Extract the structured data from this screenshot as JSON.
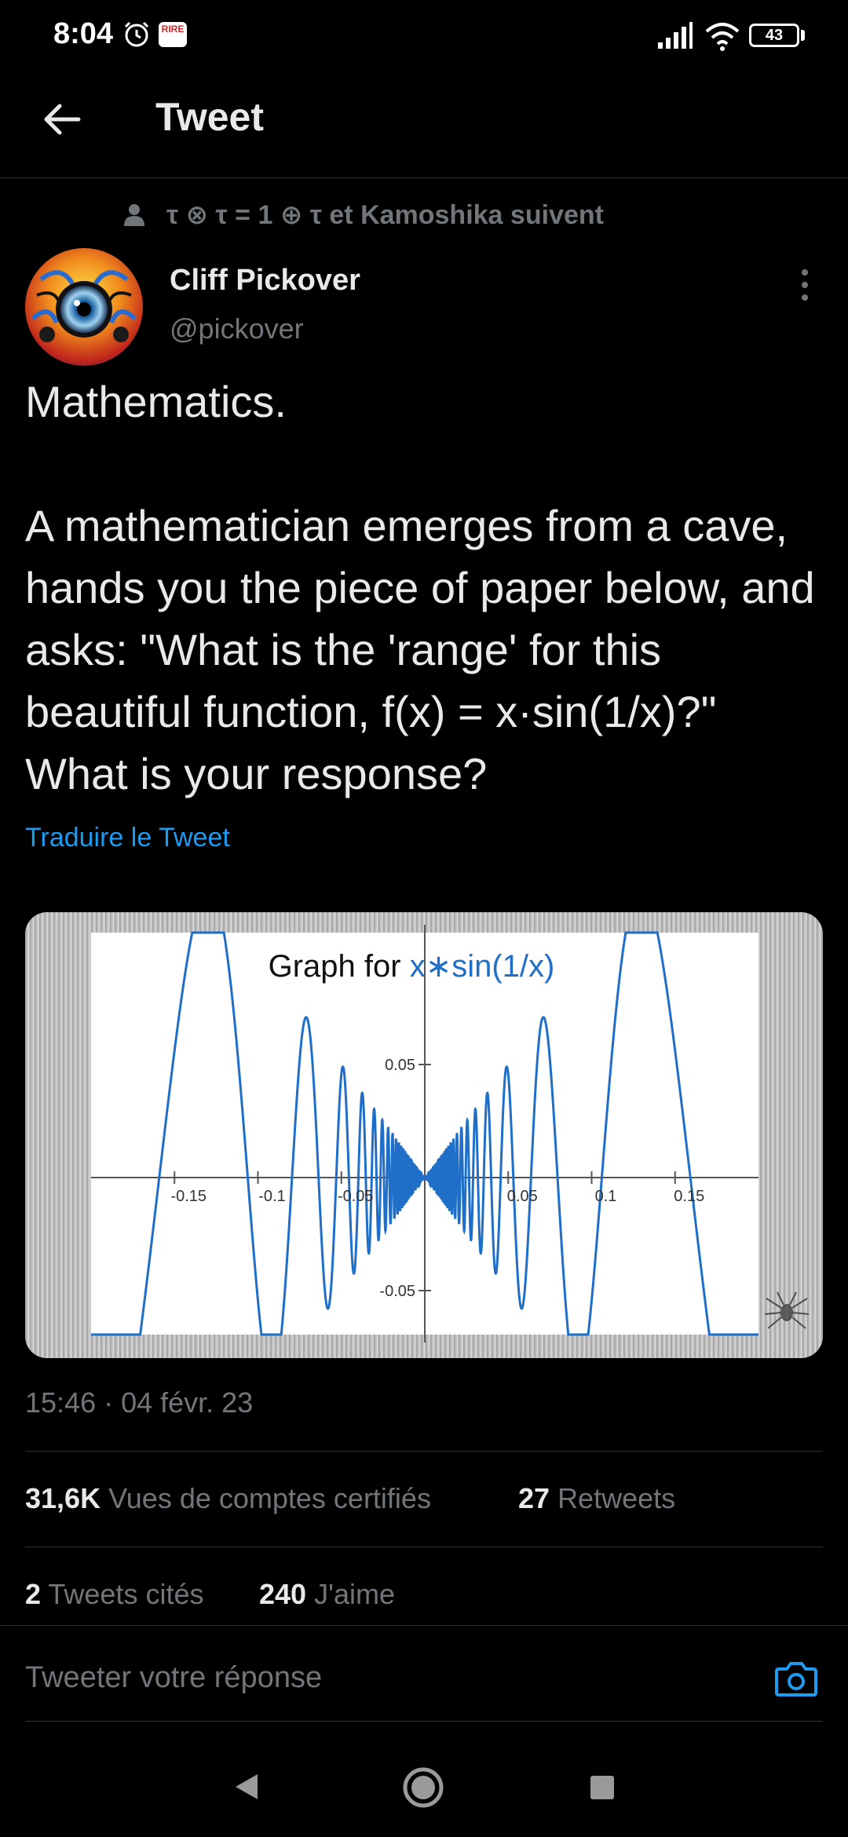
{
  "status_bar": {
    "time": "8:04",
    "app_badge": "RIRE",
    "battery": "43"
  },
  "header": {
    "title": "Tweet"
  },
  "social_context": "τ ⊗ τ = 1 ⊕ τ et Kamoshika suivent",
  "author": {
    "name": "Cliff Pickover",
    "handle": "@pickover"
  },
  "tweet": {
    "text": "Mathematics.\n\nA mathematician emerges from a cave, hands you the piece of paper below, and asks: \"What is the 'range' for this beautiful function, f(x) = x·sin(1/x)?\" What is your response?",
    "translate_label": "Traduire le Tweet"
  },
  "chart_data": {
    "type": "line",
    "title_prefix": "Graph for ",
    "title_expr": "x∗sin(1/x)",
    "function": "x*sin(1/x)",
    "xlim": [
      -0.2,
      0.2
    ],
    "ylim": [
      -0.1,
      0.1
    ],
    "x_ticks": [
      "-0.15",
      "-0.1",
      "-0.05",
      "0.05",
      "0.1",
      "0.15"
    ],
    "y_ticks": [
      "0.05",
      "-0.05"
    ],
    "grid": false,
    "line_color": "#1f6fc8"
  },
  "meta": {
    "timestamp": "15:46 · 04 févr. 23",
    "views_count": "31,6K",
    "views_label": "Vues de comptes certifiés",
    "retweets_count": "27",
    "retweets_label": "Retweets",
    "quotes_count": "2",
    "quotes_label": "Tweets cités",
    "likes_count": "240",
    "likes_label": "J'aime"
  },
  "reply": {
    "placeholder": "Tweeter votre réponse"
  },
  "colors": {
    "background": "#000000",
    "text": "#e7e9ea",
    "muted": "#71767b",
    "accent": "#1d9bf0",
    "divider": "#2f3336"
  },
  "icons": [
    "alarm-icon",
    "signal-icon",
    "wifi-icon",
    "battery-icon",
    "back-arrow-icon",
    "person-icon",
    "more-icon",
    "camera-icon",
    "nav-back-icon",
    "nav-home-icon",
    "nav-recents-icon"
  ]
}
